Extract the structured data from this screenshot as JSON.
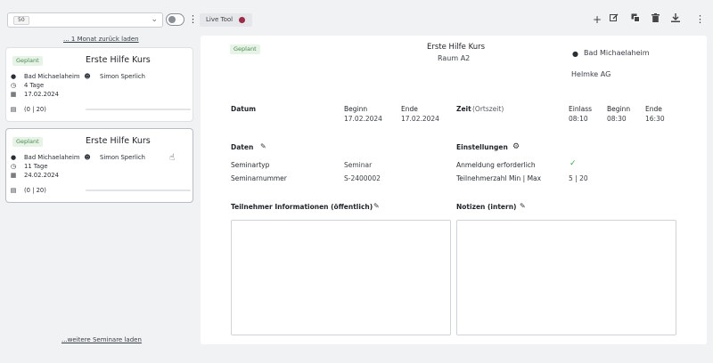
{
  "topbar": {
    "page_size": "50",
    "live_tool_label": "Live Tool"
  },
  "sidebar": {
    "load_previous": "... 1 Monat zurück laden",
    "load_more": "...weitere Seminare laden",
    "cards": [
      {
        "badge": "Geplant",
        "title": "Erste Hilfe Kurs",
        "location": "Bad Michaelaheim",
        "duration": "4 Tage",
        "date": "17.02.2024",
        "trainer": "Simon Sperlich",
        "participants": "(0 | 20)"
      },
      {
        "badge": "Geplant",
        "title": "Erste Hilfe Kurs",
        "location": "Bad Michaelaheim",
        "duration": "11 Tage",
        "date": "24.02.2024",
        "trainer": "Simon Sperlich",
        "participants": "(0 | 20)"
      }
    ]
  },
  "detail": {
    "badge": "Geplant",
    "title": "Erste Hilfe Kurs",
    "room": "Raum A2",
    "location": "Bad Michaelaheim",
    "company": "Helmke AG",
    "datum_label": "Datum",
    "begin_label": "Beginn",
    "begin_value": "17.02.2024",
    "end_label": "Ende",
    "end_value": "17.02.2024",
    "zeit_label": "Zeit",
    "zeit_sub": "(Ortszeit)",
    "einlass_label": "Einlass",
    "einlass_value": "08:10",
    "time_begin_label": "Beginn",
    "time_begin_value": "08:30",
    "time_end_label": "Ende",
    "time_end_value": "16:30",
    "daten_label": "Daten",
    "seminartyp_label": "Seminartyp",
    "seminartyp_value": "Seminar",
    "seminarnummer_label": "Seminarnummer",
    "seminarnummer_value": "S-2400002",
    "einstellungen_label": "Einstellungen",
    "anmeldung_label": "Anmeldung erforderlich",
    "teilnehmerzahl_label": "Teilnehmerzahl Min | Max",
    "teilnehmerzahl_value": "5 | 20",
    "info_label": "Teilnehmer Informationen (öffentlich)",
    "notes_label": "Notizen (intern)"
  }
}
